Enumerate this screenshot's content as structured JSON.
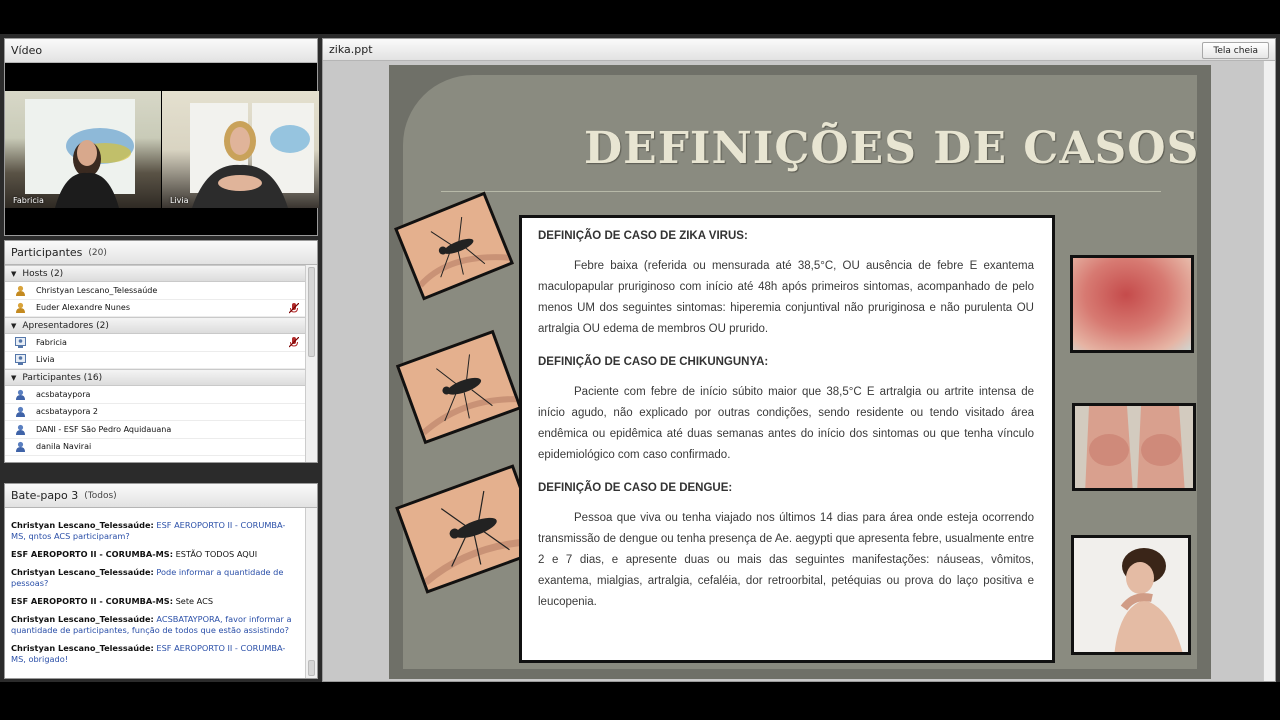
{
  "video_pod": {
    "title": "Vídeo",
    "cams": [
      {
        "name": "Fabricia"
      },
      {
        "name": "Livia"
      }
    ]
  },
  "participants_pod": {
    "title": "Participantes",
    "count": "(20)",
    "groups": [
      {
        "label": "Hosts (2)",
        "items": [
          "Christyan Lescano_Telessaúde",
          "Euder Alexandre Nunes"
        ]
      },
      {
        "label": "Apresentadores (2)",
        "items": [
          "Fabricia",
          "Livia"
        ]
      },
      {
        "label": "Participantes (16)",
        "items": [
          "acsbataypora",
          "acsbataypora 2",
          "DANI - ESF São Pedro Aquidauana",
          "danila Navirai"
        ]
      }
    ]
  },
  "chat_pod": {
    "title": "Bate-papo 3",
    "filter": "(Todos)",
    "messages": [
      {
        "sender": "Christyan Lescano_Telessaúde:",
        "text": "ESF AEROPORTO II - CORUMBA-MS, qntos ACS participaram?",
        "blue": true
      },
      {
        "sender": "ESF AEROPORTO II - CORUMBA-MS:",
        "text": "ESTÃO TODOS AQUI",
        "blue": false
      },
      {
        "sender": "Christyan Lescano_Telessaúde:",
        "text": "Pode informar a quantidade de pessoas?",
        "blue": true
      },
      {
        "sender": "ESF AEROPORTO II - CORUMBA-MS:",
        "text": "Sete ACS",
        "blue": false
      },
      {
        "sender": "Christyan Lescano_Telessaúde:",
        "text": "ACSBATAYPORA, favor informar a quantidade de participantes, função de todos que estão assistindo?",
        "blue": true
      },
      {
        "sender": "Christyan Lescano_Telessaúde:",
        "text": "ESF AEROPORTO II - CORUMBA-MS, obrigado!",
        "blue": true
      }
    ]
  },
  "share_pod": {
    "title": "zika.ppt",
    "fullscreen_label": "Tela cheia",
    "slide": {
      "title": "DEFINIÇÕES DE CASOS",
      "sections": [
        {
          "heading": "DEFINIÇÃO DE CASO DE ZIKA VIRUS:",
          "body": "Febre baixa (referida ou mensurada até 38,5°C, OU ausência de febre E exantema maculopapular pruriginoso com início até 48h após primeiros sintomas, acompanhado de pelo menos UM dos seguintes sintomas:  hiperemia conjuntival não pruriginosa e não purulenta OU artralgia OU edema de membros OU prurido."
        },
        {
          "heading": "DEFINIÇÃO DE CASO DE CHIKUNGUNYA:",
          "body": "Paciente com febre de início súbito maior que 38,5°C E artralgia ou artrite intensa de início agudo, não explicado por outras condições, sendo residente ou tendo visitado área endêmica ou epidêmica até duas semanas antes do início dos sintomas ou que tenha vínculo epidemiológico com caso confirmado."
        },
        {
          "heading": "DEFINIÇÃO DE CASO DE DENGUE:",
          "body": "Pessoa que viva ou tenha viajado nos últimos 14 dias para área onde esteja ocorrendo transmissão de dengue ou tenha presença de Ae. aegypti que apresenta febre, usualmente entre 2 e 7 dias, e apresente duas ou mais das seguintes manifestações: náuseas, vômitos, exantema, mialgias, artralgia, cefaléia, dor retroorbital, petéquias ou prova do laço positiva e leucopenia."
        }
      ]
    }
  },
  "colors": {
    "slide_bg": "#8a8b80",
    "title_color": "#e8e5d2",
    "chat_blue": "#2a4fa8"
  }
}
